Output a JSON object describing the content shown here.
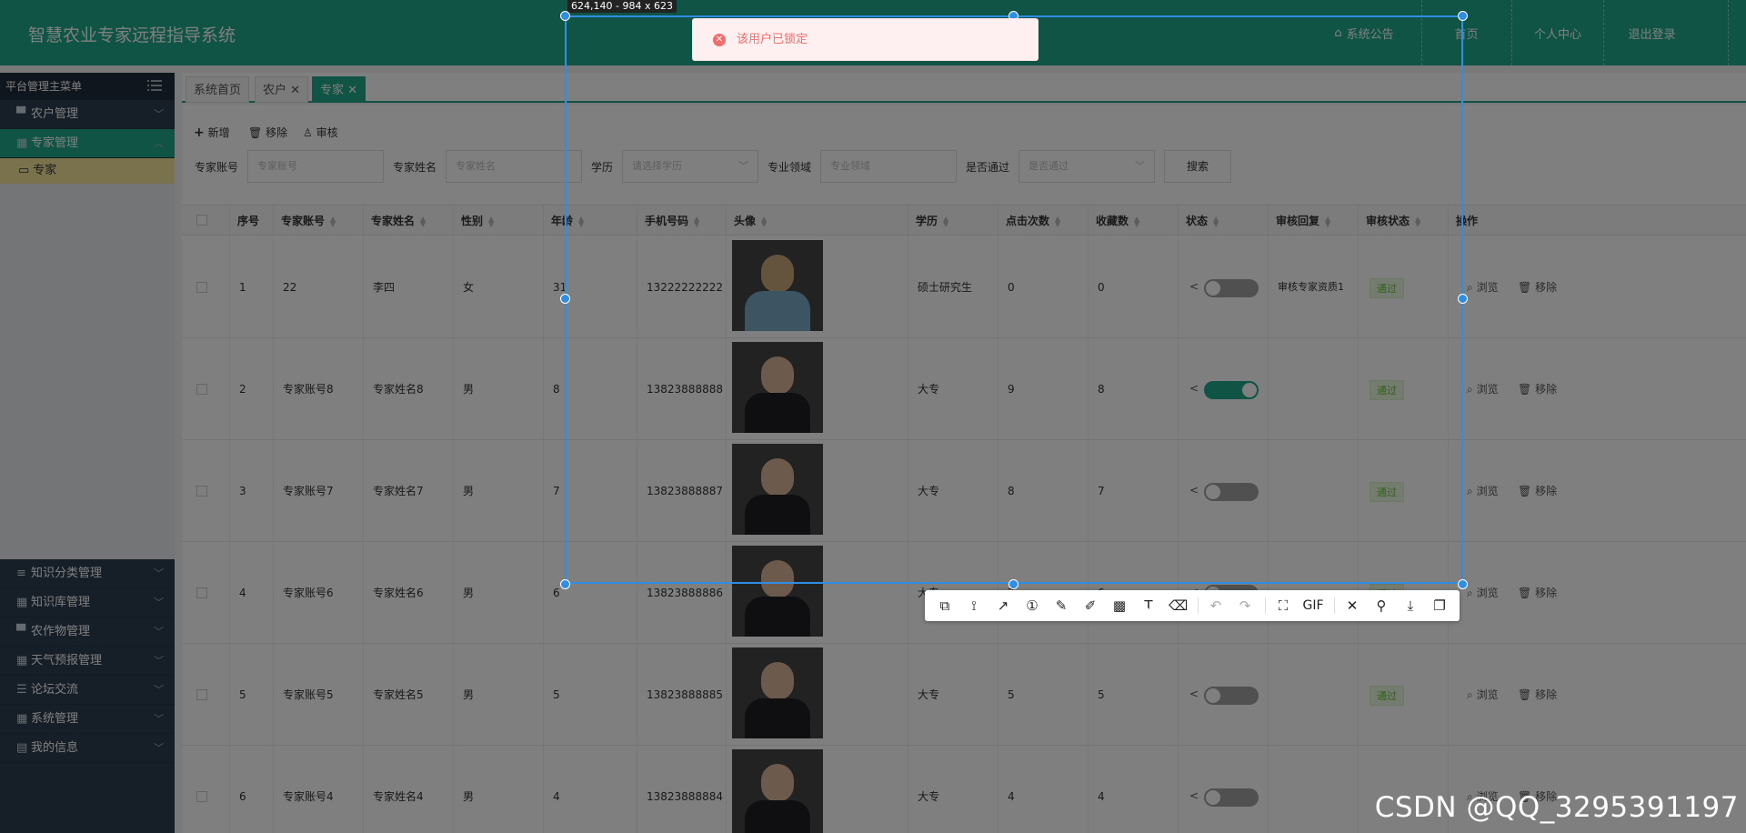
{
  "header": {
    "title": "智慧农业专家远程指导系统",
    "notice": "系统公告",
    "home": "首页",
    "profile": "个人中心",
    "logout": "退出登录"
  },
  "sidebar": {
    "title": "平台管理主菜单",
    "items": [
      {
        "label": "农户管理",
        "icon": "monitor-icon"
      },
      {
        "label": "专家管理",
        "icon": "grid-icon"
      },
      {
        "label": "专家",
        "icon": "folder-icon"
      },
      {
        "label": "知识分类管理",
        "icon": "list-icon"
      },
      {
        "label": "知识库管理",
        "icon": "grid-icon"
      },
      {
        "label": "农作物管理",
        "icon": "monitor-icon"
      },
      {
        "label": "天气预报管理",
        "icon": "grid-icon"
      },
      {
        "label": "论坛交流",
        "icon": "sliders-icon"
      },
      {
        "label": "系统管理",
        "icon": "grid-icon"
      },
      {
        "label": "我的信息",
        "icon": "card-icon"
      }
    ]
  },
  "tabs": [
    "系统首页",
    "农户",
    "专家"
  ],
  "toolbar": {
    "add": "新增",
    "remove": "移除",
    "audit": "审核"
  },
  "filters": {
    "account_label": "专家账号",
    "account_ph": "专家账号",
    "name_label": "专家姓名",
    "name_ph": "专家姓名",
    "edu_label": "学历",
    "edu_ph": "请选择学历",
    "field_label": "专业领域",
    "field_ph": "专业领域",
    "pass_label": "是否通过",
    "pass_ph": "是否通过",
    "search": "搜索"
  },
  "columns": [
    "序号",
    "专家账号",
    "专家姓名",
    "性别",
    "年龄",
    "手机号码",
    "头像",
    "学历",
    "点击次数",
    "收藏数",
    "状态",
    "审核回复",
    "审核状态",
    "操作"
  ],
  "rows": [
    {
      "no": "1",
      "account": "22",
      "name": "李四",
      "gender": "女",
      "age": "31",
      "phone": "13222222222",
      "edu": "硕士研究生",
      "clicks": "0",
      "favs": "0",
      "status_on": false,
      "reply": "审核专家资质1",
      "audit": "通过"
    },
    {
      "no": "2",
      "account": "专家账号8",
      "name": "专家姓名8",
      "gender": "男",
      "age": "8",
      "phone": "13823888888",
      "edu": "大专",
      "clicks": "9",
      "favs": "8",
      "status_on": true,
      "reply": "",
      "audit": "通过"
    },
    {
      "no": "3",
      "account": "专家账号7",
      "name": "专家姓名7",
      "gender": "男",
      "age": "7",
      "phone": "13823888887",
      "edu": "大专",
      "clicks": "8",
      "favs": "7",
      "status_on": false,
      "reply": "",
      "audit": "通过"
    },
    {
      "no": "4",
      "account": "专家账号6",
      "name": "专家姓名6",
      "gender": "男",
      "age": "6",
      "phone": "13823888886",
      "edu": "大专",
      "clicks": "7",
      "favs": "6",
      "status_on": false,
      "reply": "",
      "audit": "通过"
    },
    {
      "no": "5",
      "account": "专家账号5",
      "name": "专家姓名5",
      "gender": "男",
      "age": "5",
      "phone": "13823888885",
      "edu": "大专",
      "clicks": "5",
      "favs": "5",
      "status_on": false,
      "reply": "",
      "audit": "通过"
    },
    {
      "no": "6",
      "account": "专家账号4",
      "name": "专家姓名4",
      "gender": "男",
      "age": "4",
      "phone": "13823888884",
      "edu": "大专",
      "clicks": "4",
      "favs": "4",
      "status_on": false,
      "reply": "",
      "audit": ""
    }
  ],
  "row_actions": {
    "view": "浏览",
    "remove": "移除"
  },
  "capture": {
    "dims": "624,140 - 984 x 623",
    "toast": "该用户已锁定",
    "gif": "GIF"
  },
  "watermark": "CSDN @QQ_3295391197",
  "colors": {
    "primary": "#1ea98a",
    "sidebar": "#2d3e50",
    "selection": "#2f8de4",
    "toast_error": "#f56c6c",
    "audit_pass": "#67c23a"
  }
}
